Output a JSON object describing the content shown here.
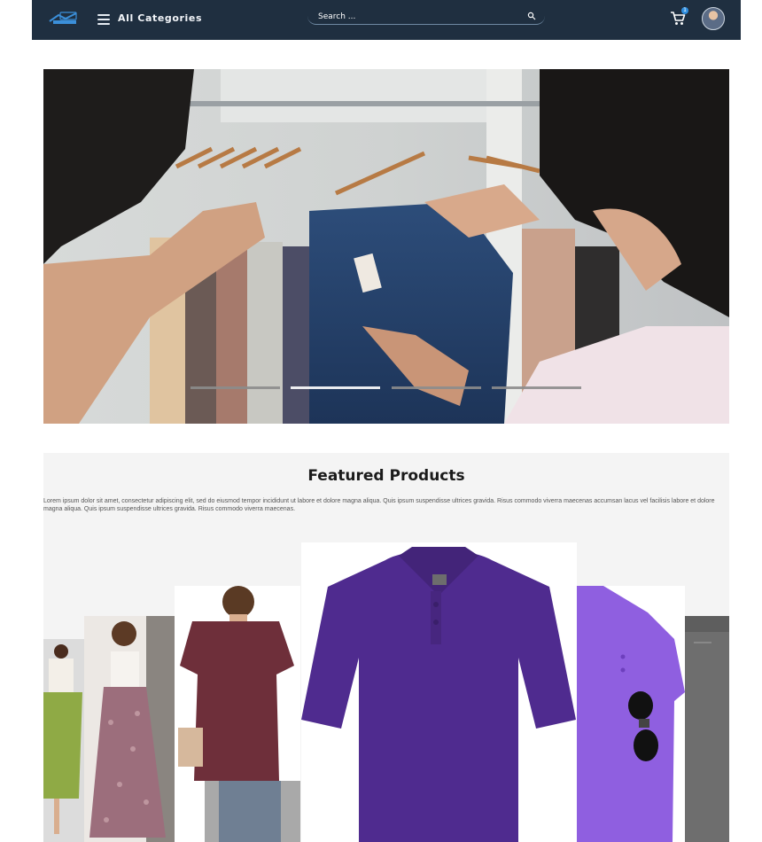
{
  "header": {
    "all_categories_label": "All Categories",
    "search": {
      "placeholder": "Search ..."
    },
    "cart": {
      "badge_count": "1"
    },
    "colors": {
      "bar": "#1f2f40",
      "badge": "#2f8fe0"
    }
  },
  "hero": {
    "slide_count": 4,
    "active_slide": 2
  },
  "featured": {
    "title": "Featured Products",
    "description": "Lorem ipsum dolor sit amet, consectetur adipiscing elit, sed do eiusmod tempor incididunt ut labore et dolore magna aliqua. Quis ipsum suspendisse ultrices gravida. Risus commodo viverra maecenas accumsan lacus vel facilisis labore et dolore magna aliqua. Quis ipsum suspendisse ultrices gravida. Risus commodo viverra maecenas.",
    "products": [
      {
        "name": "green-skirt-outfit",
        "color": "#8faa45"
      },
      {
        "name": "floral-maxi-skirt",
        "color": "#9c6e7c"
      },
      {
        "name": "maroon-vneck-top",
        "color": "#6e2f3a"
      },
      {
        "name": "purple-polo-shirt",
        "color": "#4f2b8f"
      },
      {
        "name": "lavender-polo-shirt",
        "color": "#8f5fe0"
      },
      {
        "name": "gray-pants",
        "color": "#6e6e6e"
      }
    ]
  }
}
